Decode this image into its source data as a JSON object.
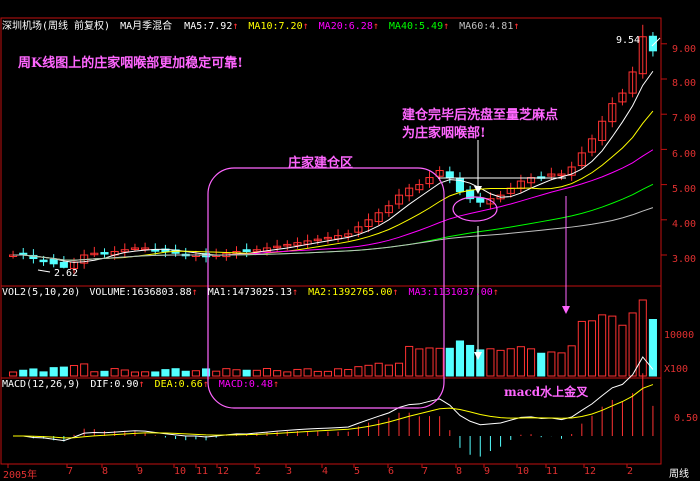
{
  "main_header": {
    "title": "深圳机场(周线 前复权)",
    "ind": "MA月季混合",
    "ma5": "MA5:7.92",
    "ma10": "MA10:7.20",
    "ma20": "MA20:6.28",
    "ma40": "MA40:5.49",
    "ma60": "MA60:4.81"
  },
  "vol_header": {
    "name": "VOL2(5,10,20)",
    "volume": "VOLUME:1636803.88",
    "ma1": "MA1:1473025.13",
    "ma2": "MA2:1392765.00",
    "ma3": "MA3:1131037.00"
  },
  "macd_header": {
    "name": "MACD(12,26,9)",
    "dif": "DIF:0.90",
    "dea": "DEA:0.66",
    "macd": "MACD:0.48"
  },
  "annotations": {
    "top_note": "周K线图上的庄家咽喉部更加稳定可靠!",
    "build_zone": "庄家建仓区",
    "throat_line1": "建仓完毕后洗盘至量芝麻点",
    "throat_line2": "为庄家咽喉部!",
    "macd_note": "macd水上金叉"
  },
  "price_labels": {
    "high": "9.54",
    "low": "2.62"
  },
  "price_axis": [
    "9.00",
    "8.00",
    "7.00",
    "6.00",
    "5.00",
    "4.00",
    "3.00"
  ],
  "vol_axis": [
    "10000",
    "X100"
  ],
  "macd_axis": [
    "0.50"
  ],
  "date_axis": [
    "2005年",
    "7",
    "8",
    "9",
    "10",
    "11",
    "12",
    "2",
    "3",
    "4",
    "5",
    "6",
    "7",
    "8",
    "9",
    "10",
    "11",
    "12",
    "2"
  ],
  "period_label": "周线",
  "colors": {
    "up": "#ff3232",
    "down": "#54ffff",
    "ma5": "#ffffff",
    "ma10": "#ffff00",
    "ma20": "#ff00ff",
    "ma40": "#00ff00",
    "ma60": "#c0c0c0",
    "annotation": "#ff66ff",
    "grid": "#c01010"
  },
  "chart_data": {
    "type": "candlestick",
    "period": "weekly",
    "y_range": [
      2.6,
      9.7
    ],
    "highlighted_high": 9.54,
    "highlighted_low": 2.62,
    "close_approx": [
      3.0,
      3.0,
      2.9,
      2.85,
      2.75,
      2.65,
      2.8,
      3.0,
      3.05,
      3.05,
      3.1,
      3.15,
      3.2,
      3.2,
      3.15,
      3.1,
      3.05,
      3.0,
      3.0,
      2.95,
      3.0,
      3.05,
      3.1,
      3.1,
      3.15,
      3.2,
      3.25,
      3.3,
      3.35,
      3.4,
      3.45,
      3.5,
      3.55,
      3.6,
      3.8,
      4.0,
      4.2,
      4.4,
      4.7,
      4.9,
      5.0,
      5.2,
      5.4,
      5.2,
      4.8,
      4.6,
      4.5,
      4.6,
      4.7,
      4.9,
      5.1,
      5.2,
      5.2,
      5.3,
      5.3,
      5.5,
      5.9,
      6.3,
      6.8,
      7.3,
      7.6,
      8.2,
      9.2,
      8.8
    ]
  }
}
